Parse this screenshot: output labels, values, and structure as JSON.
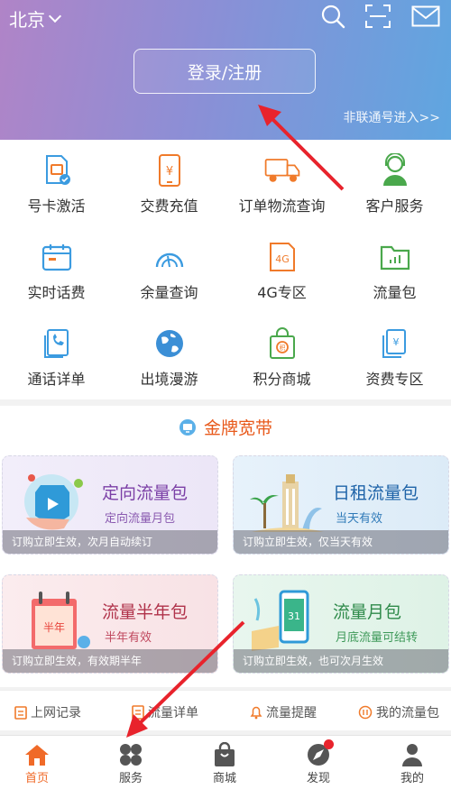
{
  "header": {
    "city": "北京",
    "login_label": "登录/注册",
    "non_unicom_label": "非联通号进入>>",
    "icons": [
      "search-icon",
      "scan-icon",
      "mail-icon"
    ]
  },
  "services": [
    {
      "label": "号卡激活",
      "icon": "sim-card-icon"
    },
    {
      "label": "交费充值",
      "icon": "phone-yen-icon"
    },
    {
      "label": "订单物流查询",
      "icon": "truck-icon"
    },
    {
      "label": "客户服务",
      "icon": "agent-icon"
    },
    {
      "label": "实时话费",
      "icon": "calendar-icon"
    },
    {
      "label": "余量查询",
      "icon": "gauge-icon"
    },
    {
      "label": "4G专区",
      "icon": "4g-icon"
    },
    {
      "label": "流量包",
      "icon": "folder-chart-icon"
    },
    {
      "label": "通话详单",
      "icon": "call-list-icon"
    },
    {
      "label": "出境漫游",
      "icon": "globe-icon"
    },
    {
      "label": "积分商城",
      "icon": "points-bag-icon"
    },
    {
      "label": "资费专区",
      "icon": "yen-doc-icon"
    }
  ],
  "broadband": {
    "title": "金牌宽带",
    "cards": [
      {
        "title": "定向流量包",
        "subtitle": "定向流量月包",
        "footer": "订购立即生效，次月自动续订"
      },
      {
        "title": "日租流量包",
        "subtitle": "当天有效",
        "footer": "订购立即生效，仅当天有效"
      },
      {
        "title": "流量半年包",
        "subtitle": "半年有效",
        "footer": "订购立即生效，有效期半年",
        "art_text": "半年"
      },
      {
        "title": "流量月包",
        "subtitle": "月底流量可结转",
        "footer": "订购立即生效，也可次月生效",
        "art_text": "31"
      }
    ]
  },
  "quick_links": [
    {
      "label": "上网记录"
    },
    {
      "label": "流量详单"
    },
    {
      "label": "流量提醒"
    },
    {
      "label": "我的流量包"
    }
  ],
  "tabs": [
    {
      "label": "首页",
      "active": true
    },
    {
      "label": "服务"
    },
    {
      "label": "商城"
    },
    {
      "label": "发现"
    },
    {
      "label": "我的"
    }
  ],
  "colors": {
    "accent": "#f06a28",
    "gradient_start": "#b084c7",
    "gradient_end": "#5fa6e0",
    "annotation_arrow": "#e8232c"
  }
}
